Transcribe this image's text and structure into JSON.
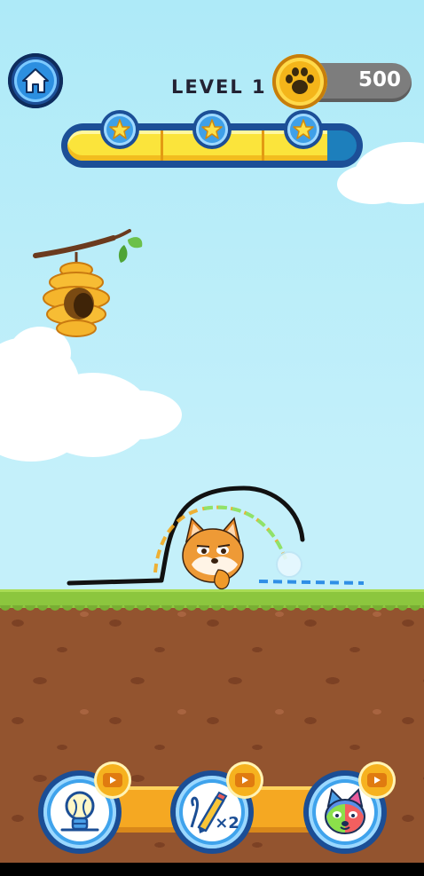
{
  "hud": {
    "level_label": "LEVEL 1",
    "coins": "500",
    "progress_fraction": 0.9,
    "stars": [
      "star-icon",
      "star-icon",
      "star-icon"
    ]
  },
  "tools": [
    {
      "name": "hint",
      "icon": "lightbulb-icon",
      "video": "video-ad-icon"
    },
    {
      "name": "extra-ink",
      "icon": "pencil-x2-icon",
      "label": "×2",
      "video": "video-ad-icon"
    },
    {
      "name": "skin",
      "icon": "rainbow-dog-icon",
      "video": "video-ad-icon"
    }
  ],
  "colors": {
    "sky": "#c4f0fa",
    "grass": "#8cc63e",
    "dirt": "#93542f",
    "accent_blue": "#1c4f97",
    "gold": "#f4b51a"
  }
}
